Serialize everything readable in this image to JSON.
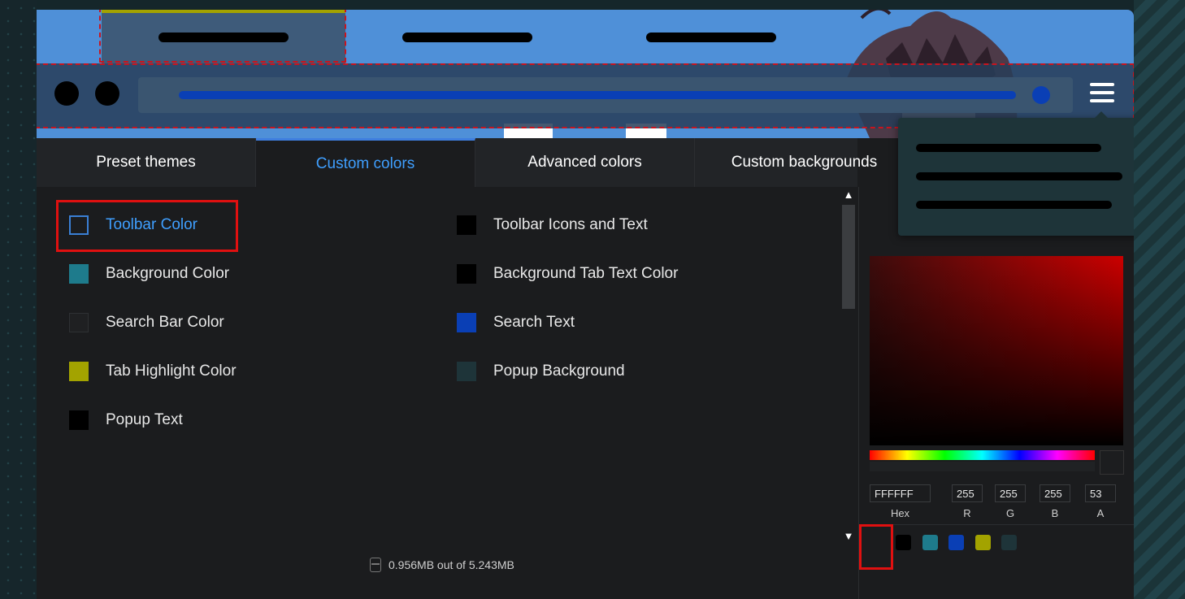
{
  "tabs": [
    {
      "label": "Preset themes",
      "active": false
    },
    {
      "label": "Custom colors",
      "active": true
    },
    {
      "label": "Advanced colors",
      "active": false
    },
    {
      "label": "Custom backgrounds",
      "active": false
    }
  ],
  "options_left": [
    {
      "label": "Toolbar Color",
      "color": "transparent",
      "active": true
    },
    {
      "label": "Background Color",
      "color": "#1e7b8c"
    },
    {
      "label": "Search Bar Color",
      "color": "#1f2022"
    },
    {
      "label": "Tab Highlight Color",
      "color": "#a3a300"
    },
    {
      "label": "Popup Text",
      "color": "#000000"
    }
  ],
  "options_right": [
    {
      "label": "Toolbar Icons and Text",
      "color": "#000000"
    },
    {
      "label": "Background Tab Text Color",
      "color": "#000000"
    },
    {
      "label": "Search Text",
      "color": "#0a3fb5"
    },
    {
      "label": "Popup Background",
      "color": "#1e3439"
    }
  ],
  "storage": {
    "text": "0.956MB out of 5.243MB"
  },
  "picker": {
    "hex": {
      "value": "FFFFFF",
      "label": "Hex"
    },
    "r": {
      "value": "255",
      "label": "R"
    },
    "g": {
      "value": "255",
      "label": "G"
    },
    "b": {
      "value": "255",
      "label": "B"
    },
    "a": {
      "value": "53",
      "label": "A"
    },
    "swatches": [
      "#1b1c1e",
      "#000000",
      "#1e7b8c",
      "#0a3fb5",
      "#a3a300",
      "#1e3439"
    ]
  },
  "preview": {
    "tab_highlight": "#a3a300",
    "toolbar_color": "#283e58",
    "search_text_color": "#0a3fb5",
    "popup_background": "#1e3439"
  }
}
